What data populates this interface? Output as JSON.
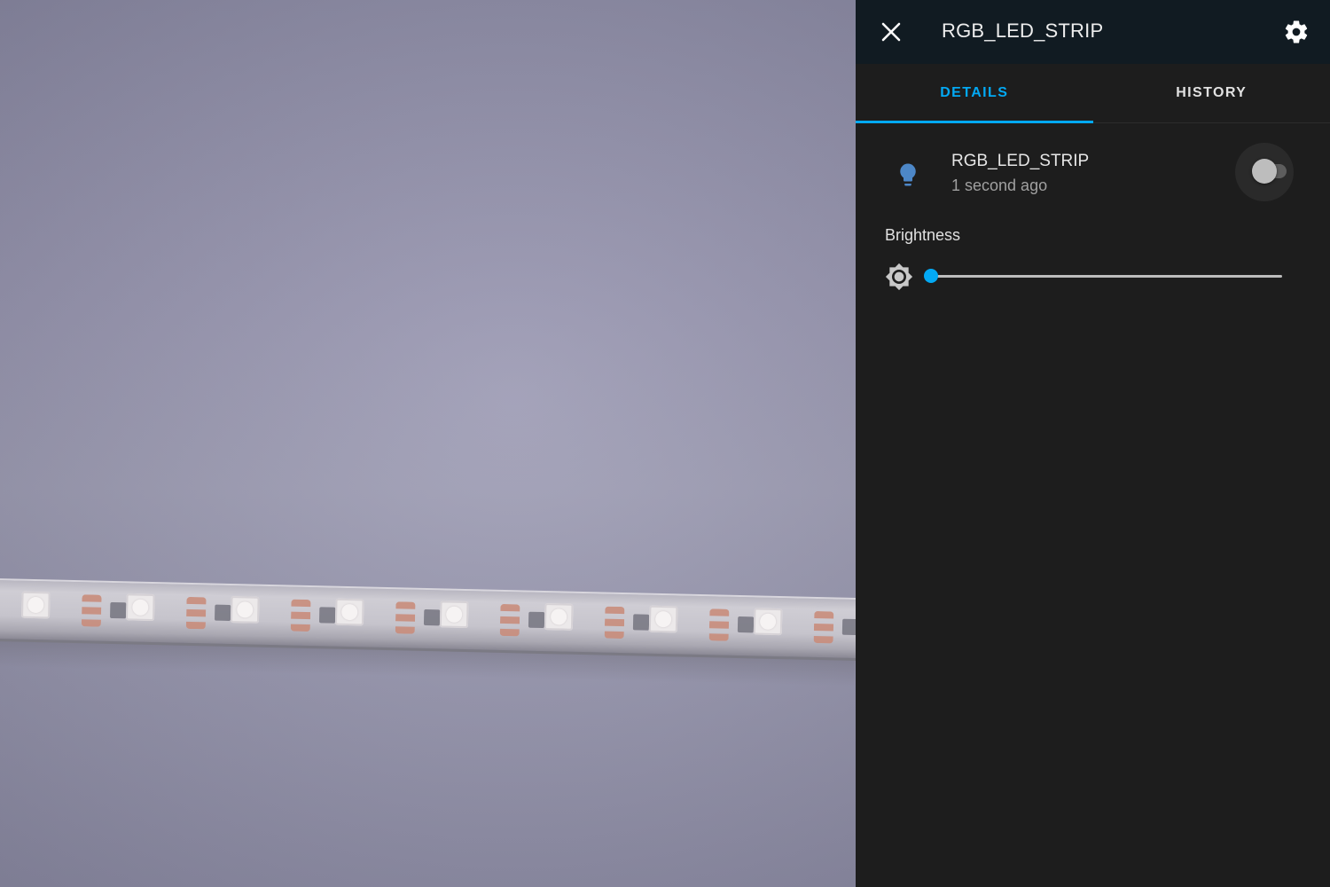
{
  "header": {
    "title": "RGB_LED_STRIP",
    "close_icon": "close-icon",
    "settings_icon": "gear-icon"
  },
  "tabs": [
    {
      "label": "DETAILS",
      "active": true
    },
    {
      "label": "HISTORY",
      "active": false
    }
  ],
  "entity": {
    "name": "RGB_LED_STRIP",
    "last_changed": "1 second ago",
    "icon": "lightbulb-icon",
    "icon_color": "#4d87c7",
    "state_on": false
  },
  "brightness": {
    "label": "Brightness",
    "icon": "brightness-icon",
    "value_fraction": 0.0
  },
  "colors": {
    "accent": "#03a9f4",
    "panel_bg": "#1d1d1d",
    "header_bg": "#111b22"
  }
}
